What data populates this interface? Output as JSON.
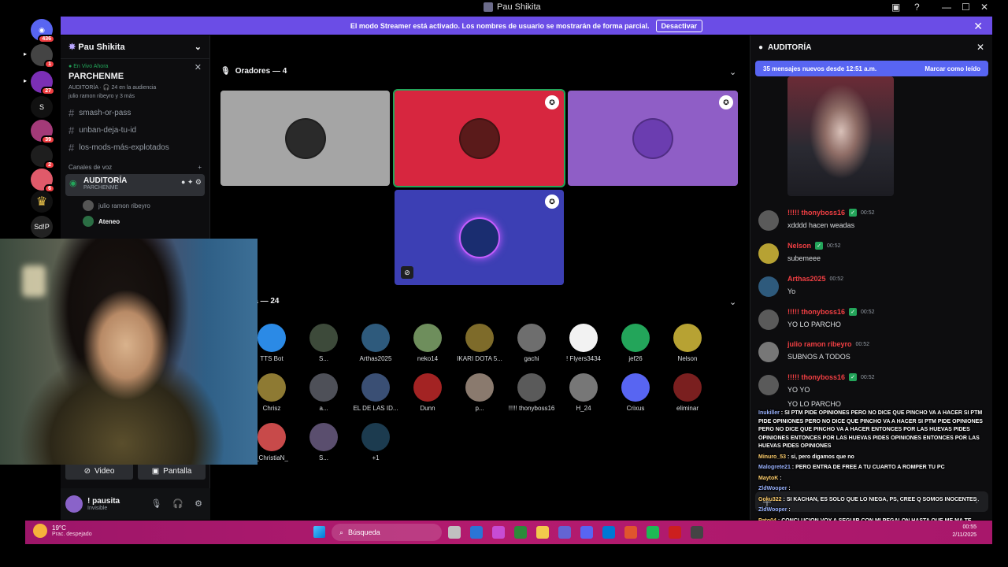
{
  "window": {
    "title": "Pau Shikita"
  },
  "banner": {
    "text": "El modo Streamer está activado. Los nombres de usuario se mostrarán de forma parcial.",
    "button": "Desactivar"
  },
  "rail": {
    "badges": [
      "436",
      "1",
      "27",
      "39",
      "2",
      "6"
    ],
    "labels": [
      "S",
      "Sd!P"
    ]
  },
  "server": {
    "name": "Pau Shikita"
  },
  "live": {
    "tag": "En Vivo Ahora",
    "name": "PARCHENME",
    "meta1": "AUDITORÍA · 🎧 24 en la audiencia",
    "meta2": "julio ramon ribeyro y 3 más"
  },
  "channels": [
    "smash-or-pass",
    "unban-deja-tu-id",
    "los-mods-más-explotados"
  ],
  "voice_category": "Canales de voz",
  "voice_channel": {
    "name": "AUDITORÍA",
    "sub": "PARCHENME",
    "users": [
      "julio ramon ribeyro",
      "Ateneo"
    ]
  },
  "media": {
    "video": "Video",
    "screen": "Pantalla"
  },
  "user": {
    "name": "! pausita",
    "status": "Invisible"
  },
  "stage": {
    "speakers_header": "Oradores — 4",
    "audience_header": "Audiencia — 24",
    "speaker_colors": [
      "#a5a5a5",
      "#d7263f",
      "#8f5ec6",
      "#3c3fb4"
    ],
    "audience": [
      {
        "name": "TTS Bot",
        "color": "#2b8ae6"
      },
      {
        "name": "S...",
        "color": "#3d4a3a"
      },
      {
        "name": "Arthas2025",
        "color": "#2e5a7c"
      },
      {
        "name": "neko14",
        "color": "#6e8e5c"
      },
      {
        "name": "IKARI DOTA 5...",
        "color": "#7e6b2a"
      },
      {
        "name": "gachi",
        "color": "#6e6e6e"
      },
      {
        "name": "! Flyers3434",
        "color": "#f2f2f2"
      },
      {
        "name": "jef26",
        "color": "#23a55a"
      },
      {
        "name": "Nelson",
        "color": "#b7a233"
      },
      {
        "name": "Chrisz",
        "color": "#8e7a33"
      },
      {
        "name": "a...",
        "color": "#4e5058"
      },
      {
        "name": "EL DE LAS ID...",
        "color": "#3a4f74"
      },
      {
        "name": "Dunn",
        "color": "#a32323"
      },
      {
        "name": "p...",
        "color": "#8a7a6e"
      },
      {
        "name": "!!!!! thonyboss16",
        "color": "#5a5a5a"
      },
      {
        "name": "H_24",
        "color": "#777777"
      },
      {
        "name": "Crixus",
        "color": "#5865f2"
      },
      {
        "name": "eliminar",
        "color": "#7a1f1f"
      },
      {
        "name": "_ChristiaN_",
        "color": "#c84a4a"
      },
      {
        "name": "S...",
        "color": "#5a4e6e"
      },
      {
        "name": "+1",
        "color": "#1c3b4f"
      }
    ]
  },
  "chat": {
    "title": "AUDITORÍA",
    "new_messages": "35 mensajes nuevos desde 12:51 a.m.",
    "mark_read": "Marcar como leído",
    "messages": [
      {
        "user": "!!!!! thonyboss16",
        "time": "00:52",
        "lines": [
          "xdddd hacen weadas"
        ],
        "verified": true,
        "color": "#5a5a5a"
      },
      {
        "user": "Nelson",
        "time": "00:52",
        "lines": [
          "subemeee"
        ],
        "verified": true,
        "color": "#b7a233"
      },
      {
        "user": "Arthas2025",
        "time": "00:52",
        "lines": [
          "Yo"
        ],
        "verified": false,
        "color": "#2e5a7c"
      },
      {
        "user": "!!!!! thonyboss16",
        "time": "00:52",
        "lines": [
          "YO LO PARCHO"
        ],
        "verified": true,
        "color": "#5a5a5a"
      },
      {
        "user": "julio ramon ribeyro",
        "time": "00:52",
        "lines": [
          "SUBNOS A TODOS"
        ],
        "verified": false,
        "color": "#777777"
      },
      {
        "user": "!!!!! thonyboss16",
        "time": "00:52",
        "lines": [
          "YO YO",
          "YO LO PARCHO"
        ],
        "verified": true,
        "color": "#5a5a5a"
      }
    ]
  },
  "overlay": [
    {
      "name": "Inukiller",
      "text": "SI PTM PIDE OPINIONES PERO NO DICE QUE PINCHO VA A HACER SI PTM PIDE OPINIONES PERO NO DICE QUE PINCHO VA A HACER SI PTM PIDE OPINIONES PERO NO DICE QUE PINCHO VA A HACER ENTONCES POR LAS HUEVAS PIDES OPINIONES ENTONCES POR LAS HUEVAS PIDES OPINIONES ENTONCES POR LAS HUEVAS PIDES OPINIONES"
    },
    {
      "name": "Minuro_53",
      "text": "si, pero digamos que no"
    },
    {
      "name": "Malogrete21",
      "text": "PERO ENTRA DE FREE A TU CUARTO A ROMPER TU PC"
    },
    {
      "name": "MaytoK",
      "text": ""
    },
    {
      "name": "ZldWooper",
      "text": ""
    },
    {
      "name": "Goku322",
      "text": "SI KACHAN, ES SOLO QUE LO NIEGA, PS, CREE Q SOMOS INOCENTES"
    },
    {
      "name": "ZldWooper",
      "text": ""
    },
    {
      "name": "Pato04",
      "text": "CONCLUCION VOY A SEGUIR CON MI PEGALON HASTA QUE ME MA TE"
    },
    {
      "name": "ZldWooper",
      "text": ""
    }
  ],
  "taskbar": {
    "temp": "19°C",
    "weather": "Prac. despejado",
    "search": "Búsqueda",
    "time": "00:55",
    "date": "2/11/2025",
    "icon_colors": [
      "#c0c0c0",
      "#2a75d6",
      "#c74cd4",
      "#2c8a3a",
      "#f2c94c",
      "#6364d3",
      "#5865f2",
      "#0078d4",
      "#e0552e",
      "#1db954",
      "#cc1f1f",
      "#444444"
    ]
  }
}
